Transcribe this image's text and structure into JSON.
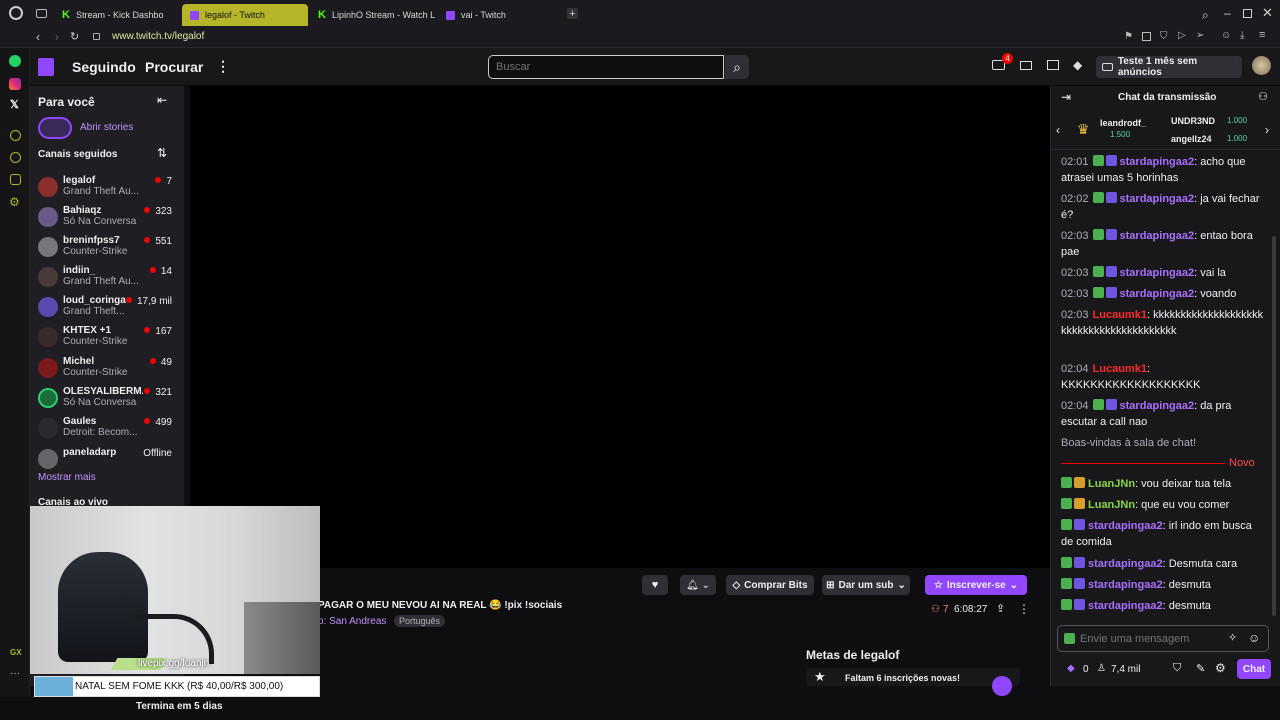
{
  "browser": {
    "tabs": [
      {
        "label": "Stream - Kick Dashbo"
      },
      {
        "label": "legalof - Twitch"
      },
      {
        "label": "LipinhO Stream - Watch L"
      },
      {
        "label": "vai - Twitch"
      }
    ],
    "url": "www.twitch.tv/legalof"
  },
  "nav": {
    "following": "Seguindo",
    "browse": "Procurar",
    "search_placeholder": "Buscar",
    "notif_count": "4",
    "promo": "Teste 1 mês sem anúncios"
  },
  "sidebar": {
    "title": "Para você",
    "stories": "Abrir stories",
    "followed": "Canais seguidos",
    "channels": [
      {
        "name": "legalof",
        "game": "Grand Theft Au...",
        "viewers": "7"
      },
      {
        "name": "Bahiaqz",
        "game": "Só Na Conversa",
        "viewers": "323"
      },
      {
        "name": "breninfpss7",
        "game": "Counter-Strike",
        "viewers": "551"
      },
      {
        "name": "indiin_",
        "game": "Grand Theft Au...",
        "viewers": "14"
      },
      {
        "name": "loud_coringa",
        "game": "Grand Theft...",
        "viewers": "17,9 mil"
      },
      {
        "name": "KHTEX +1",
        "game": "Counter-Strike",
        "viewers": "167"
      },
      {
        "name": "Michel",
        "game": "Counter-Strike",
        "viewers": "49"
      },
      {
        "name": "OLESYALIBERM...",
        "game": "Só Na Conversa",
        "viewers": "321"
      },
      {
        "name": "Gaules",
        "game": "Detroit: Becom...",
        "viewers": "499"
      }
    ],
    "offline_name": "paneladarp",
    "offline_label": "Offline",
    "show_more": "Mostrar mais",
    "live_channels": "Canais ao vivo"
  },
  "stream": {
    "title": "PAGAR O MEU NEVOU AI NA REAL 😂 !pix !sociais",
    "category": "o: San Andreas",
    "tag": "Português",
    "viewers": "7",
    "uptime": "6:08:27",
    "bits": "Comprar Bits",
    "gift": "Dar um sub",
    "subscribe": "Inscrever-se",
    "goals_title": "Metas de legalof",
    "goal_text": "Faltam 6 inscrições novas!"
  },
  "overlay": {
    "livepix": "livepix.gg/luanjn",
    "goal": "NATAL SEM FOME KKK (R$ 40,00/R$ 300,00)",
    "ends": "Termina em 5 dias"
  },
  "chat": {
    "title": "Chat da transmissão",
    "leader1": {
      "name": "leandrodf_",
      "amount": "1.500"
    },
    "leader2": {
      "name": "UNDR3ND",
      "amount": "1.000"
    },
    "leader3": {
      "name": "angellz24",
      "amount": "1.000"
    },
    "messages": [
      {
        "time": "02:01",
        "user": "stardapingaa2",
        "text": ": acho que atrasei umas 5 horinhas"
      },
      {
        "time": "02:02",
        "user": "stardapingaa2",
        "text": ": ja vai fechar é?"
      },
      {
        "time": "02:03",
        "user": "stardapingaa2",
        "text": ": entao bora pae"
      },
      {
        "time": "02:03",
        "user": "stardapingaa2",
        "text": ": vai la"
      },
      {
        "time": "02:03",
        "user": "stardapingaa2",
        "text": ": voando"
      },
      {
        "time": "02:03",
        "user": "Lucaumk1",
        "text": ": kkkkkkkkkkkkkkkkkkkkkkkkkkkkkkkkkkkkkkkkk"
      },
      {
        "time": "02:04",
        "user": "Lucaumk1",
        "text": ": KKKKKKKKKKKKKKKKKKK"
      },
      {
        "time": "02:04",
        "user": "stardapingaa2",
        "text": ": da pra escutar a call nao"
      }
    ],
    "welcome": "Boas-vindas à sala de chat!",
    "new_label": "Novo",
    "new_messages": [
      {
        "user": "LuanJNn",
        "text": ": vou deixar tua tela"
      },
      {
        "user": "LuanJNn",
        "text": ": que eu vou comer"
      },
      {
        "user": "stardapingaa2",
        "text": ": irl indo em busca de comida"
      },
      {
        "user": "stardapingaa2",
        "text": ": Desmuta cara"
      },
      {
        "user": "stardapingaa2",
        "text": ": desmuta"
      },
      {
        "user": "stardapingaa2",
        "text": ": desmuta"
      }
    ],
    "input_placeholder": "Envie uma mensagem",
    "bits_count": "0",
    "points": "7,4 mil",
    "send": "Chat"
  },
  "colors": {
    "accent": "#9147ff",
    "tab_active": "#b5b52a"
  }
}
